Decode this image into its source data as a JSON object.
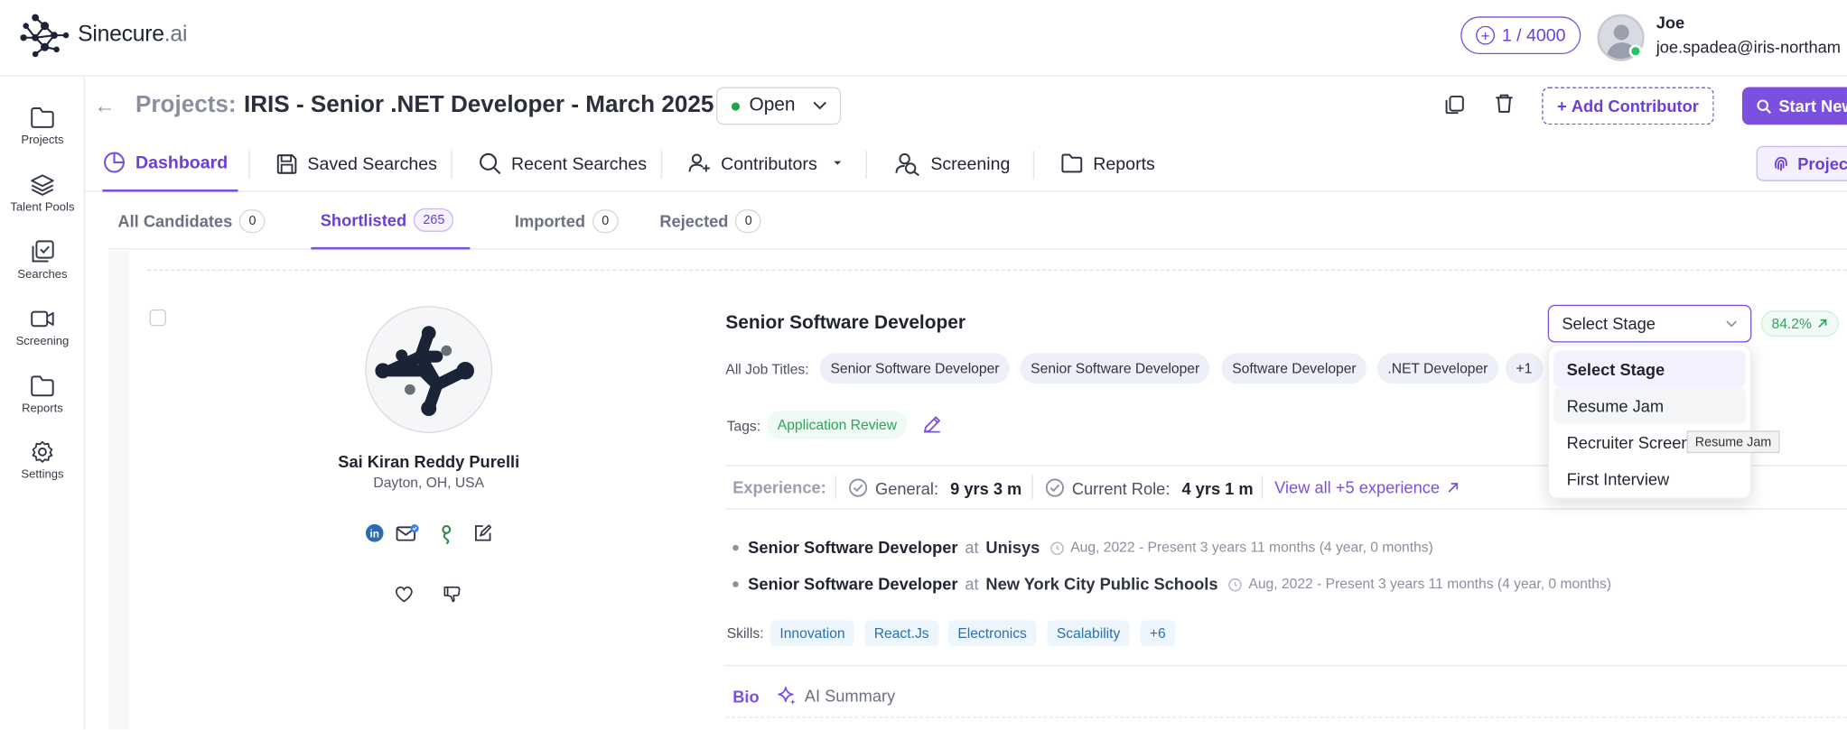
{
  "app": {
    "logo_name": "Sinecure",
    "logo_suffix": ".ai",
    "credits": "1 / 4000",
    "user_name": "Joe",
    "user_email": "joe.spadea@iris-northam"
  },
  "sidebar": {
    "items": [
      {
        "label": "Projects",
        "icon": "folder-icon"
      },
      {
        "label": "Talent Pools",
        "icon": "layers-icon"
      },
      {
        "label": "Searches",
        "icon": "search-stack-icon"
      },
      {
        "label": "Screening",
        "icon": "video-icon"
      },
      {
        "label": "Reports",
        "icon": "folder-icon"
      },
      {
        "label": "Settings",
        "icon": "gear-icon"
      }
    ]
  },
  "project": {
    "label": "Projects:",
    "title": "IRIS - Senior .NET Developer - March 2025",
    "status": "Open",
    "add_contributor": "Add Contributor",
    "start_new": "Start New",
    "project_btn": "Project"
  },
  "nav_tabs": {
    "dashboard": "Dashboard",
    "saved": "Saved Searches",
    "recent": "Recent Searches",
    "contributors": "Contributors",
    "screening": "Screening",
    "reports": "Reports"
  },
  "candidate_tabs": [
    {
      "label": "All Candidates",
      "count": "0"
    },
    {
      "label": "Shortlisted",
      "count": "265"
    },
    {
      "label": "Imported",
      "count": "0"
    },
    {
      "label": "Rejected",
      "count": "0"
    }
  ],
  "candidate": {
    "name": "Sai Kiran Reddy Purelli",
    "location": "Dayton, OH, USA",
    "job_title": "Senior Software Developer",
    "all_job_titles_label": "All Job Titles:",
    "job_titles": [
      "Senior Software Developer",
      "Senior Software Developer",
      "Software Developer",
      ".NET Developer",
      "+1"
    ],
    "tags_label": "Tags:",
    "tags": [
      "Application Review"
    ],
    "experience_label": "Experience:",
    "general_label": "General:",
    "general_value": "9 yrs 3 m",
    "current_label": "Current Role:",
    "current_value": "4 yrs 1 m",
    "view_all": "View all +5 experience",
    "history": [
      {
        "role": "Senior Software Developer",
        "at": "at",
        "org": "Unisys",
        "dates": "Aug, 2022 - Present 3 years 11 months (4 year, 0 months)"
      },
      {
        "role": "Senior Software Developer",
        "at": "at",
        "org": "New York City Public Schools",
        "dates": "Aug, 2022 - Present 3 years 11 months (4 year, 0 months)"
      }
    ],
    "skills_label": "Skills:",
    "skills": [
      "Innovation",
      "React.Js",
      "Electronics",
      "Scalability",
      "+6"
    ],
    "bio_tab": "Bio",
    "ai_summary_tab": "AI Summary"
  },
  "stage": {
    "placeholder": "Select Stage",
    "score": "84.2%",
    "options": [
      "Select Stage",
      "Resume Jam",
      "Recruiter Screen",
      "First Interview"
    ],
    "tooltip": "Resume Jam"
  },
  "colors": {
    "accent": "#7b4fe0",
    "green": "#2ea35a",
    "skill_blue": "#2a6fb0"
  }
}
